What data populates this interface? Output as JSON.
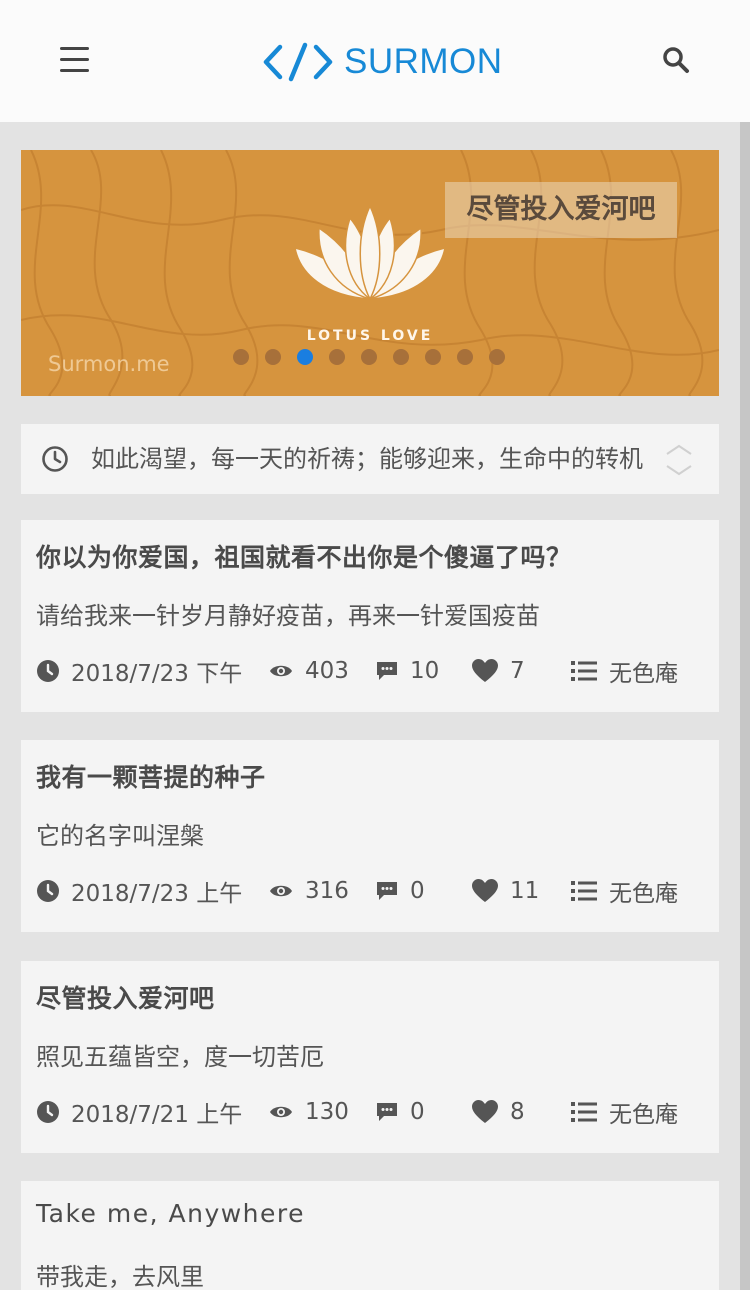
{
  "header": {
    "logo_text": "SURMON"
  },
  "banner": {
    "title": "尽管投入爱河吧",
    "caption": "LOTUS LOVE",
    "watermark": "Surmon.me",
    "slide_count": 9,
    "active_slide": 3
  },
  "announcement": {
    "text": "如此渴望，每一天的祈祷；能够迎来，生命中的转机"
  },
  "articles": [
    {
      "title": "你以为你爱国，祖国就看不出你是个傻逼了吗？",
      "description": "请给我来一针岁月静好疫苗，再来一针爱国疫苗",
      "date": "2018/7/23 下午",
      "views": "403",
      "comments": "10",
      "likes": "7",
      "category": "无色庵"
    },
    {
      "title": "我有一颗菩提的种子",
      "description": "它的名字叫涅槃",
      "date": "2018/7/23 上午",
      "views": "316",
      "comments": "0",
      "likes": "11",
      "category": "无色庵"
    },
    {
      "title": "尽管投入爱河吧",
      "description": "照见五蕴皆空，度一切苦厄",
      "date": "2018/7/21 上午",
      "views": "130",
      "comments": "0",
      "likes": "8",
      "category": "无色庵"
    },
    {
      "title": "Take me, Anywhere",
      "description": "带我走，去风里",
      "date": "",
      "views": "",
      "comments": "",
      "likes": "",
      "category": ""
    }
  ],
  "colors": {
    "brand": "#1789d6",
    "active_dot": "#1a7ee0",
    "banner_bg": "#d6943e",
    "page_bg": "#e3e3e3",
    "card_bg": "#f4f4f4"
  },
  "icons": {
    "menu": "menu-icon",
    "search": "search-icon",
    "announcement": "clock-icon",
    "date": "clock-solid-icon",
    "views": "eye-icon",
    "comments": "comment-icon",
    "likes": "heart-icon",
    "category": "list-icon"
  }
}
